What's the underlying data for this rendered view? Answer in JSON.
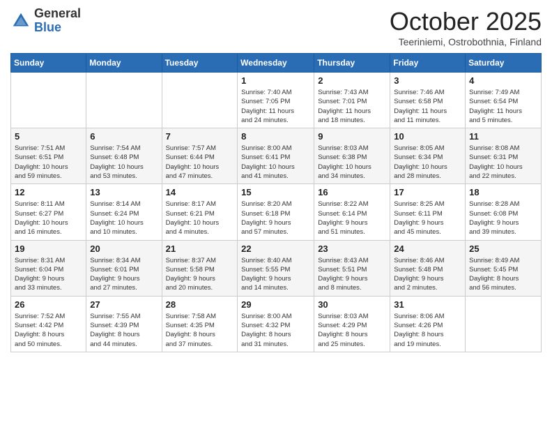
{
  "logo": {
    "general": "General",
    "blue": "Blue"
  },
  "header": {
    "month": "October 2025",
    "location": "Teeriniemi, Ostrobothnia, Finland"
  },
  "weekdays": [
    "Sunday",
    "Monday",
    "Tuesday",
    "Wednesday",
    "Thursday",
    "Friday",
    "Saturday"
  ],
  "weeks": [
    [
      {
        "day": "",
        "info": ""
      },
      {
        "day": "",
        "info": ""
      },
      {
        "day": "",
        "info": ""
      },
      {
        "day": "1",
        "info": "Sunrise: 7:40 AM\nSunset: 7:05 PM\nDaylight: 11 hours\nand 24 minutes."
      },
      {
        "day": "2",
        "info": "Sunrise: 7:43 AM\nSunset: 7:01 PM\nDaylight: 11 hours\nand 18 minutes."
      },
      {
        "day": "3",
        "info": "Sunrise: 7:46 AM\nSunset: 6:58 PM\nDaylight: 11 hours\nand 11 minutes."
      },
      {
        "day": "4",
        "info": "Sunrise: 7:49 AM\nSunset: 6:54 PM\nDaylight: 11 hours\nand 5 minutes."
      }
    ],
    [
      {
        "day": "5",
        "info": "Sunrise: 7:51 AM\nSunset: 6:51 PM\nDaylight: 10 hours\nand 59 minutes."
      },
      {
        "day": "6",
        "info": "Sunrise: 7:54 AM\nSunset: 6:48 PM\nDaylight: 10 hours\nand 53 minutes."
      },
      {
        "day": "7",
        "info": "Sunrise: 7:57 AM\nSunset: 6:44 PM\nDaylight: 10 hours\nand 47 minutes."
      },
      {
        "day": "8",
        "info": "Sunrise: 8:00 AM\nSunset: 6:41 PM\nDaylight: 10 hours\nand 41 minutes."
      },
      {
        "day": "9",
        "info": "Sunrise: 8:03 AM\nSunset: 6:38 PM\nDaylight: 10 hours\nand 34 minutes."
      },
      {
        "day": "10",
        "info": "Sunrise: 8:05 AM\nSunset: 6:34 PM\nDaylight: 10 hours\nand 28 minutes."
      },
      {
        "day": "11",
        "info": "Sunrise: 8:08 AM\nSunset: 6:31 PM\nDaylight: 10 hours\nand 22 minutes."
      }
    ],
    [
      {
        "day": "12",
        "info": "Sunrise: 8:11 AM\nSunset: 6:27 PM\nDaylight: 10 hours\nand 16 minutes."
      },
      {
        "day": "13",
        "info": "Sunrise: 8:14 AM\nSunset: 6:24 PM\nDaylight: 10 hours\nand 10 minutes."
      },
      {
        "day": "14",
        "info": "Sunrise: 8:17 AM\nSunset: 6:21 PM\nDaylight: 10 hours\nand 4 minutes."
      },
      {
        "day": "15",
        "info": "Sunrise: 8:20 AM\nSunset: 6:18 PM\nDaylight: 9 hours\nand 57 minutes."
      },
      {
        "day": "16",
        "info": "Sunrise: 8:22 AM\nSunset: 6:14 PM\nDaylight: 9 hours\nand 51 minutes."
      },
      {
        "day": "17",
        "info": "Sunrise: 8:25 AM\nSunset: 6:11 PM\nDaylight: 9 hours\nand 45 minutes."
      },
      {
        "day": "18",
        "info": "Sunrise: 8:28 AM\nSunset: 6:08 PM\nDaylight: 9 hours\nand 39 minutes."
      }
    ],
    [
      {
        "day": "19",
        "info": "Sunrise: 8:31 AM\nSunset: 6:04 PM\nDaylight: 9 hours\nand 33 minutes."
      },
      {
        "day": "20",
        "info": "Sunrise: 8:34 AM\nSunset: 6:01 PM\nDaylight: 9 hours\nand 27 minutes."
      },
      {
        "day": "21",
        "info": "Sunrise: 8:37 AM\nSunset: 5:58 PM\nDaylight: 9 hours\nand 20 minutes."
      },
      {
        "day": "22",
        "info": "Sunrise: 8:40 AM\nSunset: 5:55 PM\nDaylight: 9 hours\nand 14 minutes."
      },
      {
        "day": "23",
        "info": "Sunrise: 8:43 AM\nSunset: 5:51 PM\nDaylight: 9 hours\nand 8 minutes."
      },
      {
        "day": "24",
        "info": "Sunrise: 8:46 AM\nSunset: 5:48 PM\nDaylight: 9 hours\nand 2 minutes."
      },
      {
        "day": "25",
        "info": "Sunrise: 8:49 AM\nSunset: 5:45 PM\nDaylight: 8 hours\nand 56 minutes."
      }
    ],
    [
      {
        "day": "26",
        "info": "Sunrise: 7:52 AM\nSunset: 4:42 PM\nDaylight: 8 hours\nand 50 minutes."
      },
      {
        "day": "27",
        "info": "Sunrise: 7:55 AM\nSunset: 4:39 PM\nDaylight: 8 hours\nand 44 minutes."
      },
      {
        "day": "28",
        "info": "Sunrise: 7:58 AM\nSunset: 4:35 PM\nDaylight: 8 hours\nand 37 minutes."
      },
      {
        "day": "29",
        "info": "Sunrise: 8:00 AM\nSunset: 4:32 PM\nDaylight: 8 hours\nand 31 minutes."
      },
      {
        "day": "30",
        "info": "Sunrise: 8:03 AM\nSunset: 4:29 PM\nDaylight: 8 hours\nand 25 minutes."
      },
      {
        "day": "31",
        "info": "Sunrise: 8:06 AM\nSunset: 4:26 PM\nDaylight: 8 hours\nand 19 minutes."
      },
      {
        "day": "",
        "info": ""
      }
    ]
  ]
}
